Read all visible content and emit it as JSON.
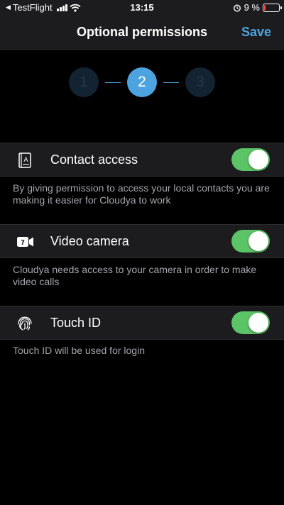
{
  "status_bar": {
    "carrier": "TestFlight",
    "time": "13:15",
    "battery_percent_label": "9 %",
    "battery_level": 0.09,
    "back_arrow": "◀"
  },
  "nav": {
    "title": "Optional permissions",
    "save_label": "Save"
  },
  "stepper": {
    "steps": [
      "1",
      "2",
      "3"
    ],
    "active_step": 2
  },
  "permissions": [
    {
      "label": "Contact access",
      "icon": "contacts-book-icon",
      "enabled": true,
      "description": "By giving permission to access your local contacts you are making it easier for Cloudya to work"
    },
    {
      "label": "Video camera",
      "icon": "video-camera-icon",
      "enabled": true,
      "description": "Cloudya needs access to your camera in order to make video calls"
    },
    {
      "label": "Touch ID",
      "icon": "fingerprint-icon",
      "enabled": true,
      "description": "Touch ID will be used for login"
    }
  ],
  "colors": {
    "accent": "#4da3e0",
    "toggle_on": "#5bc467",
    "row_background": "#1c1c1e",
    "description_text": "#a5a5aa"
  }
}
